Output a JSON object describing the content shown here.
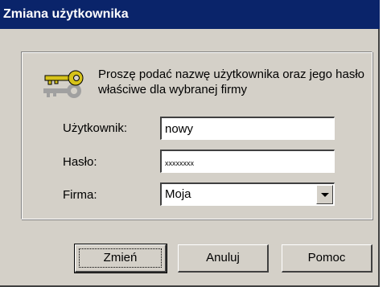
{
  "window": {
    "title": "Zmiana użytkownika"
  },
  "info": {
    "icon": "key-icon",
    "text": "Proszę podać nazwę użytkownika oraz jego hasło właściwe dla wybranej firmy"
  },
  "form": {
    "user_label": "Użytkownik:",
    "user_value": "nowy",
    "password_label": "Hasło:",
    "password_value": "xxxxxxxx",
    "company_label": "Firma:",
    "company_value": "Moja"
  },
  "buttons": {
    "change": "Zmień",
    "cancel": "Anuluj",
    "help": "Pomoc"
  },
  "colors": {
    "titlebar": "#0a246a",
    "face": "#d4d0c8",
    "key": "#d6c21a"
  }
}
